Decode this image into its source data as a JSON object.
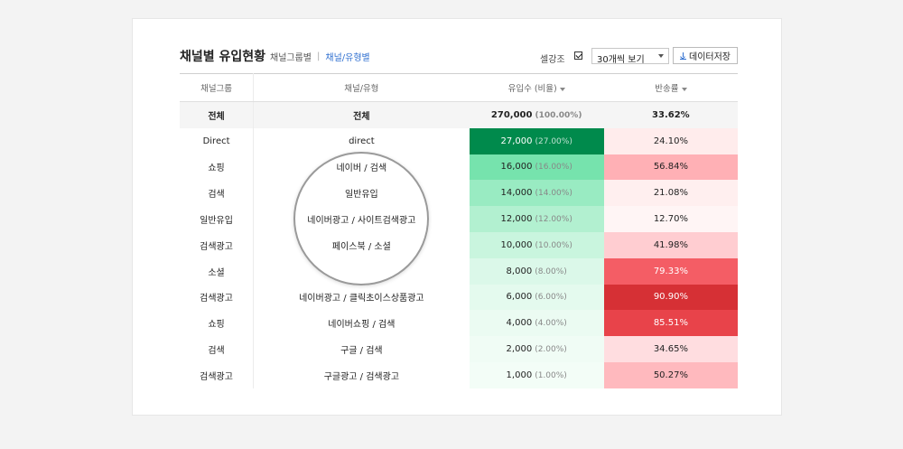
{
  "header": {
    "title": "채널별 유입현황",
    "tab_group": "채널그룹별",
    "tab_type": "채널/유형별",
    "heat_label": "셀강조",
    "select_value": "30개씩 보기",
    "save_label": "데이터저장"
  },
  "table": {
    "columns": [
      "채널그룹",
      "채널/유형",
      "유입수 (비율)",
      "반송률"
    ],
    "total": {
      "group": "전체",
      "channel": "전체",
      "count": "270,000",
      "share": "(100.00%)",
      "bounce": "33.62%"
    },
    "rows": [
      {
        "group": "Direct",
        "channel": "direct",
        "count": "27,000",
        "share": "(27.00%)",
        "bounce": "24.10%",
        "count_bg": "#008a4c",
        "bounce_bg": "#ffecec",
        "dark_count": true,
        "dark_bounce": false
      },
      {
        "group": "쇼핑",
        "channel": "네이버 / 검색",
        "count": "16,000",
        "share": "(16.00%)",
        "bounce": "56.84%",
        "count_bg": "#76e3ad",
        "bounce_bg": "#ffb0b5",
        "dark_count": false,
        "dark_bounce": false
      },
      {
        "group": "검색",
        "channel": "일반유입",
        "count": "14,000",
        "share": "(14.00%)",
        "bounce": "21.08%",
        "count_bg": "#99ebc2",
        "bounce_bg": "#ffefef",
        "dark_count": false,
        "dark_bounce": false
      },
      {
        "group": "일반유입",
        "channel": "네이버광고 / 사이트검색광고",
        "count": "12,000",
        "share": "(12.00%)",
        "bounce": "12.70%",
        "count_bg": "#b2f0d0",
        "bounce_bg": "#fff5f5",
        "dark_count": false,
        "dark_bounce": false
      },
      {
        "group": "검색광고",
        "channel": "페이스북 / 소셜",
        "count": "10,000",
        "share": "(10.00%)",
        "bounce": "41.98%",
        "count_bg": "#c9f5de",
        "bounce_bg": "#ffcdd1",
        "dark_count": false,
        "dark_bounce": false
      },
      {
        "group": "소셜",
        "channel": "",
        "count": "8,000",
        "share": "(8.00%)",
        "bounce": "79.33%",
        "count_bg": "#dbf8e9",
        "bounce_bg": "#f45d65",
        "dark_count": false,
        "dark_bounce": true
      },
      {
        "group": "검색광고",
        "channel": "네이버광고 / 클릭초이스상품광고",
        "count": "6,000",
        "share": "(6.00%)",
        "bounce": "90.90%",
        "count_bg": "#e4faee",
        "bounce_bg": "#d63035",
        "dark_count": false,
        "dark_bounce": true
      },
      {
        "group": "쇼핑",
        "channel": "네이버쇼핑 / 검색",
        "count": "4,000",
        "share": "(4.00%)",
        "bounce": "85.51%",
        "count_bg": "#ebfbf2",
        "bounce_bg": "#e8434a",
        "dark_count": false,
        "dark_bounce": true
      },
      {
        "group": "검색",
        "channel": "구글 / 검색",
        "count": "2,000",
        "share": "(2.00%)",
        "bounce": "34.65%",
        "count_bg": "#f0fcf5",
        "bounce_bg": "#ffdde0",
        "dark_count": false,
        "dark_bounce": false
      },
      {
        "group": "검색광고",
        "channel": "구글광고 / 검색광고",
        "count": "1,000",
        "share": "(1.00%)",
        "bounce": "50.27%",
        "count_bg": "#f3fdf7",
        "bounce_bg": "#ffb9be",
        "dark_count": false,
        "dark_bounce": false
      }
    ]
  }
}
